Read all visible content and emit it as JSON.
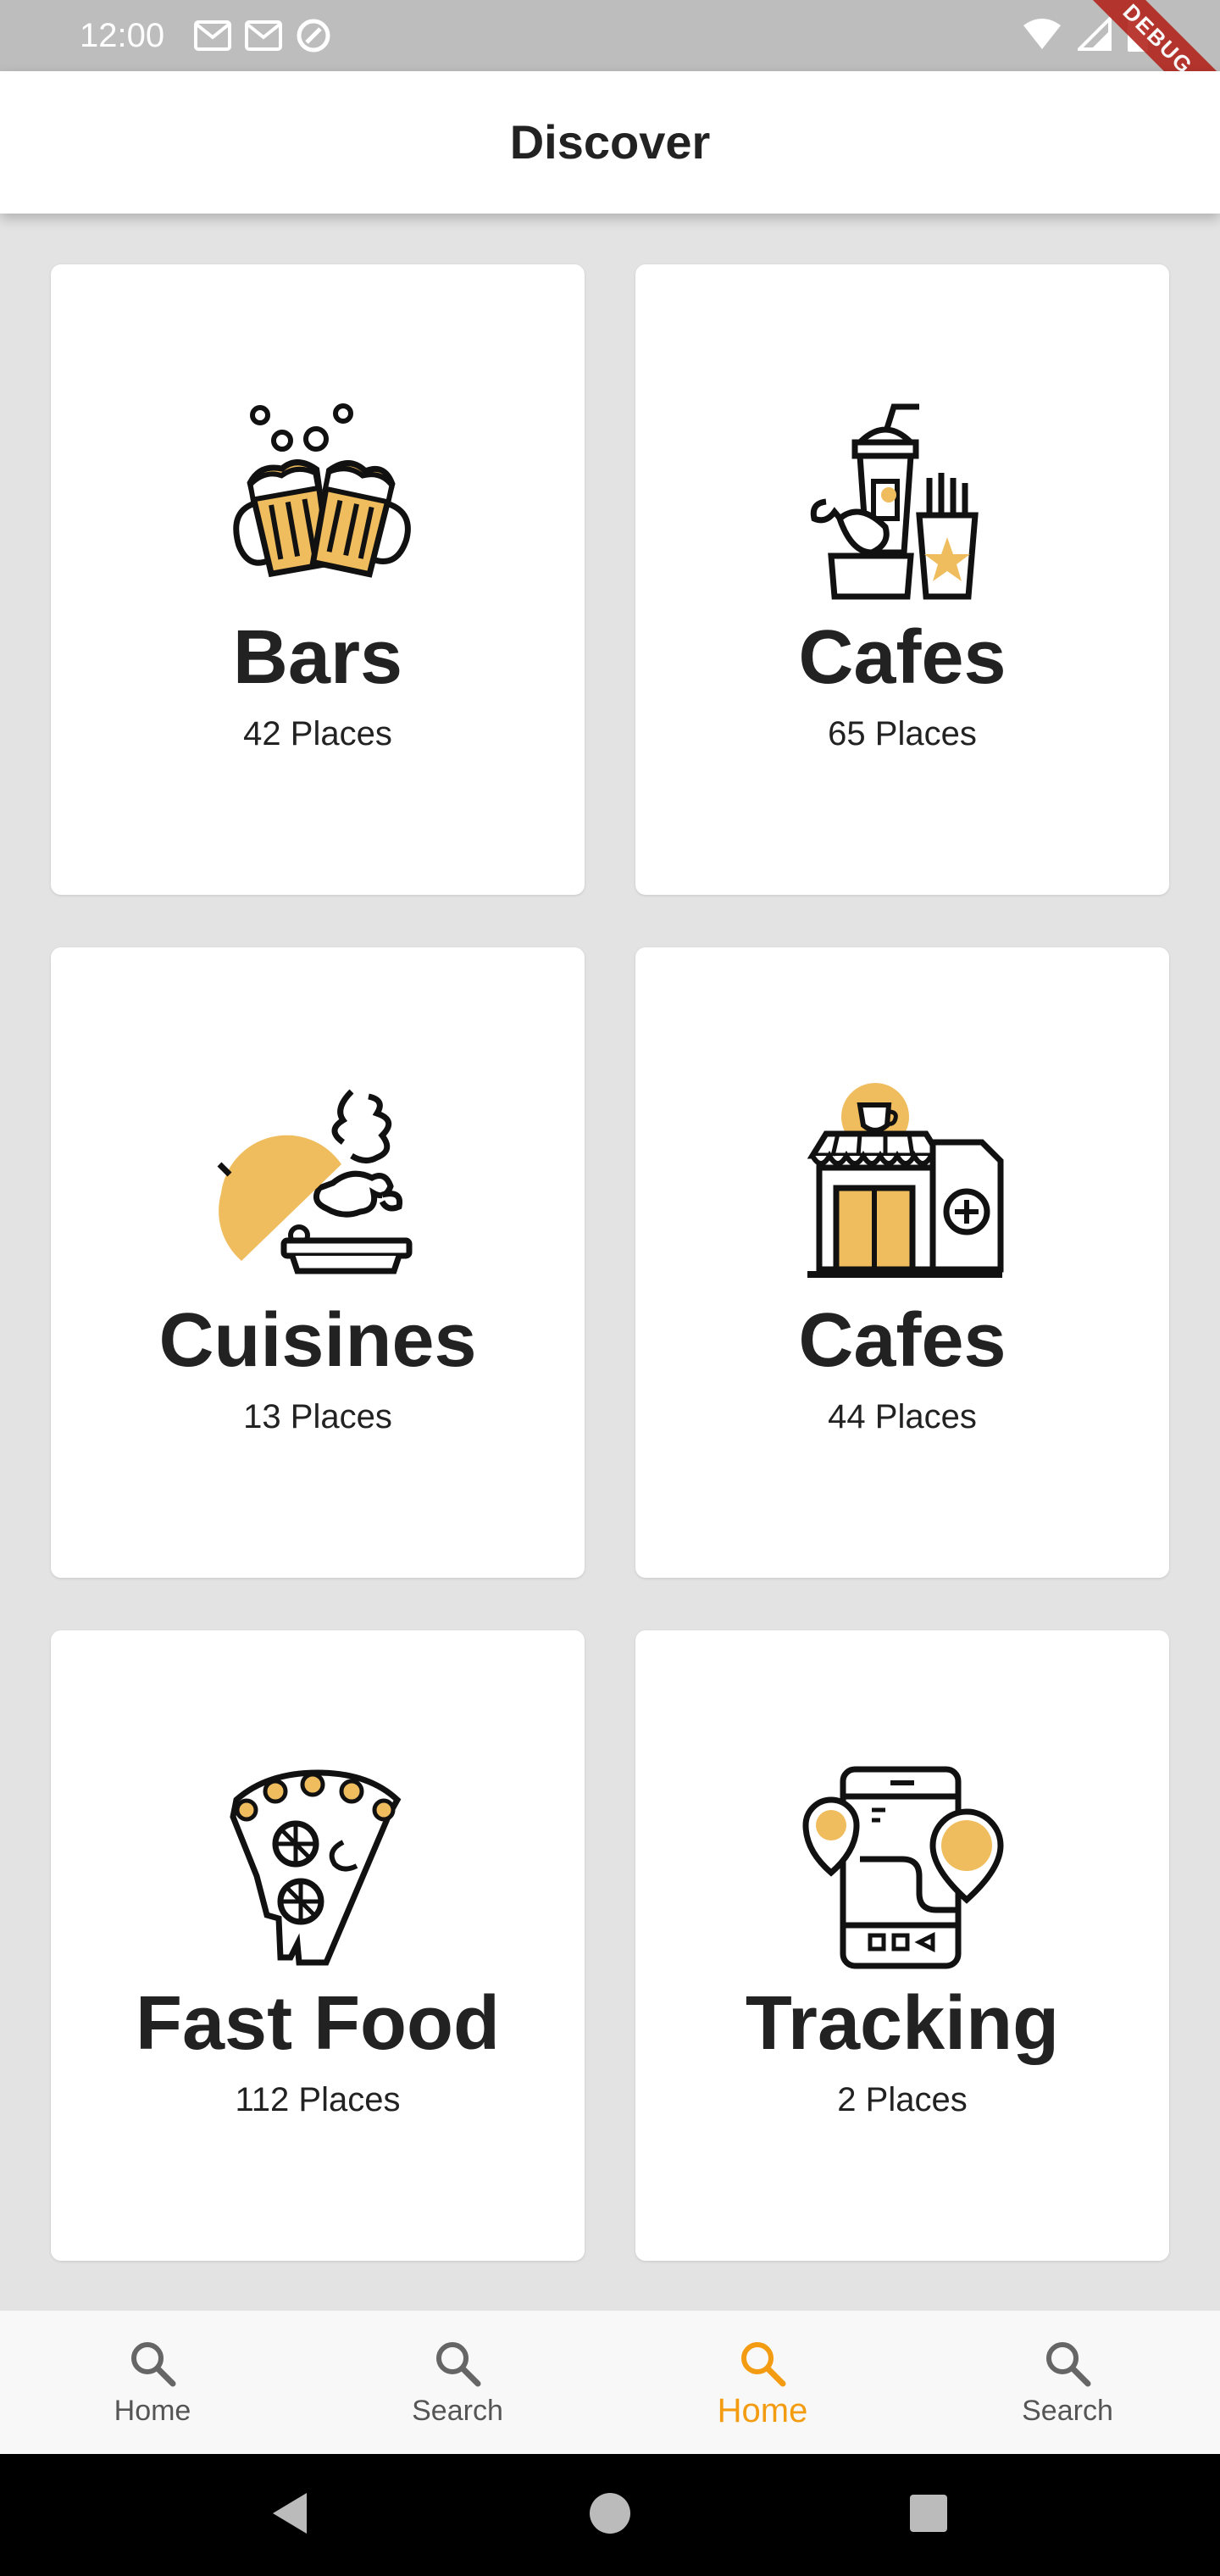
{
  "status_bar": {
    "time": "12:00",
    "debug_label": "DEBUG"
  },
  "app_bar": {
    "title": "Discover"
  },
  "categories": [
    {
      "title": "Bars",
      "subtitle": "42 Places",
      "icon": "beer-mugs-icon"
    },
    {
      "title": "Cafes",
      "subtitle": "65 Places",
      "icon": "fast-food-combo-icon"
    },
    {
      "title": "Cuisines",
      "subtitle": "13 Places",
      "icon": "cloche-dish-icon"
    },
    {
      "title": "Cafes",
      "subtitle": "44 Places",
      "icon": "cafe-storefront-icon"
    },
    {
      "title": "Fast Food",
      "subtitle": "112 Places",
      "icon": "pizza-slice-icon"
    },
    {
      "title": "Tracking",
      "subtitle": "2 Places",
      "icon": "phone-map-pin-icon"
    }
  ],
  "bottom_nav": [
    {
      "label": "Home",
      "icon": "search-icon",
      "active": false
    },
    {
      "label": "Search",
      "icon": "search-icon",
      "active": false
    },
    {
      "label": "Home",
      "icon": "search-icon",
      "active": true
    },
    {
      "label": "Search",
      "icon": "search-icon",
      "active": false
    }
  ],
  "colors": {
    "accent": "#f39c12",
    "icon_fill": "#f0bd5e",
    "background": "#e3e3e3",
    "card": "#ffffff",
    "status_bar": "#bdbdbd"
  }
}
